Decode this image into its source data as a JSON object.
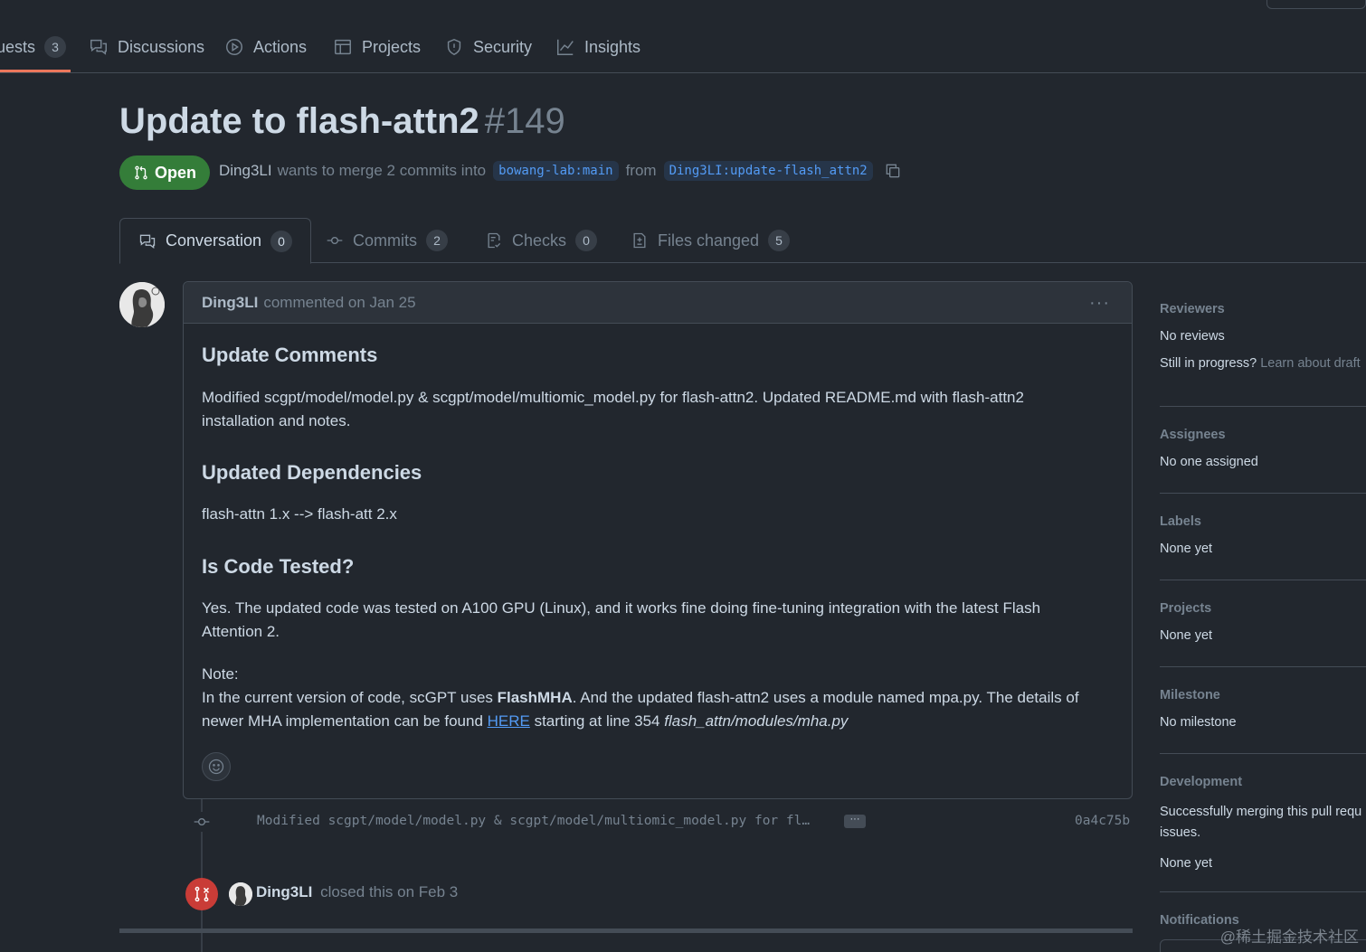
{
  "nav": {
    "items": [
      {
        "label": "uests",
        "count": "3",
        "icon": "pull-request-icon"
      },
      {
        "label": "Discussions",
        "icon": "discussion-icon"
      },
      {
        "label": "Actions",
        "icon": "play-icon"
      },
      {
        "label": "Projects",
        "icon": "table-icon"
      },
      {
        "label": "Security",
        "icon": "shield-icon"
      },
      {
        "label": "Insights",
        "icon": "graph-icon"
      }
    ]
  },
  "pr": {
    "title": "Update to flash-attn2",
    "number": "#149",
    "state": "Open",
    "author": "Ding3LI",
    "merge_text": "wants to merge 2 commits into",
    "base_branch": "bowang-lab:main",
    "from_text": "from",
    "head_branch": "Ding3LI:update-flash_attn2"
  },
  "tabs": [
    {
      "label": "Conversation",
      "count": "0"
    },
    {
      "label": "Commits",
      "count": "2"
    },
    {
      "label": "Checks",
      "count": "0"
    },
    {
      "label": "Files changed",
      "count": "5"
    }
  ],
  "comment": {
    "author": "Ding3LI",
    "meta": "commented on Jan 25",
    "menu": "···",
    "h1": "Update Comments",
    "p1": "Modified scgpt/model/model.py & scgpt/model/multiomic_model.py for flash-attn2. Updated README.md with flash-attn2",
    "p1b": "installation and notes.",
    "h2": "Updated Dependencies",
    "p2": "flash-attn 1.x --> flash-att 2.x",
    "h3": "Is Code Tested?",
    "p3": "Yes. The updated code was tested on A100 GPU (Linux), and it works fine doing fine-tuning integration with the latest Flash",
    "p3b": "Attention 2.",
    "note_label": "Note:",
    "note_a": "In the current version of code, scGPT uses ",
    "note_bold": "FlashMHA",
    "note_b": ". And the updated flash-attn2 uses a module named mpa.py. The details of",
    "note_c": "newer MHA implementation can be found ",
    "note_link": "HERE",
    "note_d": " starting at line 354 ",
    "note_italic": "flash_attn/modules/mha.py"
  },
  "timeline": {
    "commit_message": "Modified scgpt/model/model.py & scgpt/model/multiomic_model.py for fl…",
    "commit_more": "···",
    "commit_sha": "0a4c75b",
    "closed_author": "Ding3LI",
    "closed_text": "closed this on Feb 3"
  },
  "sidebar": {
    "reviewers_title": "Reviewers",
    "reviewers_value": "No reviews",
    "reviewers_hint": "Still in progress?",
    "reviewers_link": "Learn about draft",
    "assignees_title": "Assignees",
    "assignees_value": "No one assigned",
    "labels_title": "Labels",
    "labels_value": "None yet",
    "projects_title": "Projects",
    "projects_value": "None yet",
    "milestone_title": "Milestone",
    "milestone_value": "No milestone",
    "development_title": "Development",
    "development_text1": "Successfully merging this pull requ",
    "development_text2": "issues.",
    "development_value": "None yet",
    "notifications_title": "Notifications"
  },
  "watermark": "@稀土掘金技术社区",
  "colors": {
    "background": "#22272e",
    "open_green": "#347d39",
    "closed_red": "#c93c37",
    "link_blue": "#539bf5",
    "accent_orange": "#ec775c"
  }
}
